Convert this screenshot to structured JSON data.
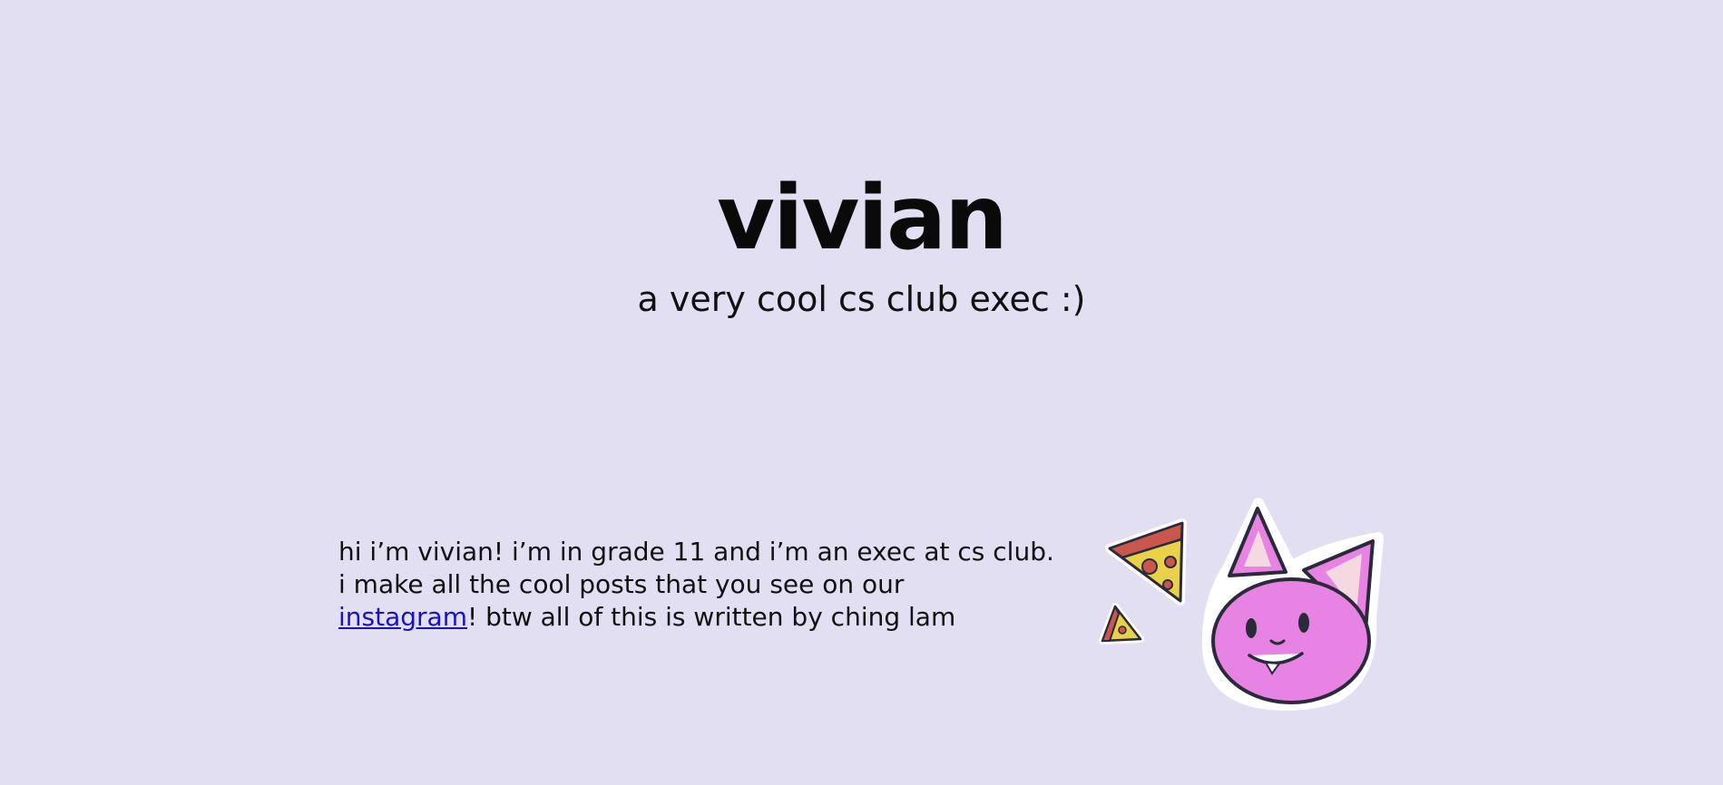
{
  "header": {
    "title": "vivian",
    "subtitle": "a very cool cs club exec :)"
  },
  "bio": {
    "line1": "hi i’m vivian! i’m in grade 11 and i’m an exec at cs club.",
    "line2": "i make all the cool posts that you see on our",
    "link_label": "instagram",
    "line3_rest": "! btw all of this is written by ching lam"
  },
  "illustration": {
    "icons": [
      "pizza-slice-icon",
      "small-pizza-slice-icon",
      "pink-cat-face-icon"
    ]
  },
  "colors": {
    "background": "#e3dff3",
    "text": "#111111",
    "link": "#1a10c8",
    "cat_fill": "#e683e3",
    "pizza_crust": "#c9574e",
    "pizza_cheese": "#e8d24a"
  }
}
